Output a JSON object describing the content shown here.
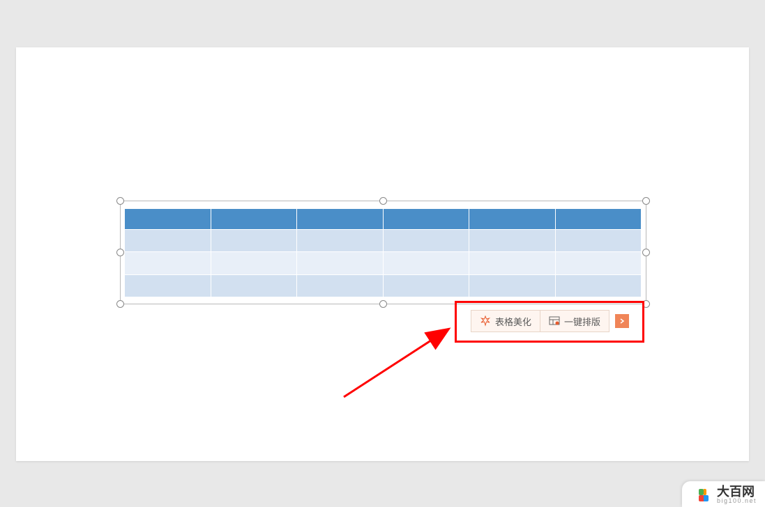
{
  "toolbar": {
    "beautify_label": "表格美化",
    "layout_label": "一键排版"
  },
  "table": {
    "columns": 6,
    "rows": 4
  },
  "watermark": {
    "title": "大百网",
    "url": "big100.net"
  },
  "colors": {
    "header": "#4a8ec8",
    "light_row": "#d2e0f0",
    "lighter_row": "#e8eff8",
    "highlight": "#ff0000",
    "expand_btn": "#f08558"
  }
}
